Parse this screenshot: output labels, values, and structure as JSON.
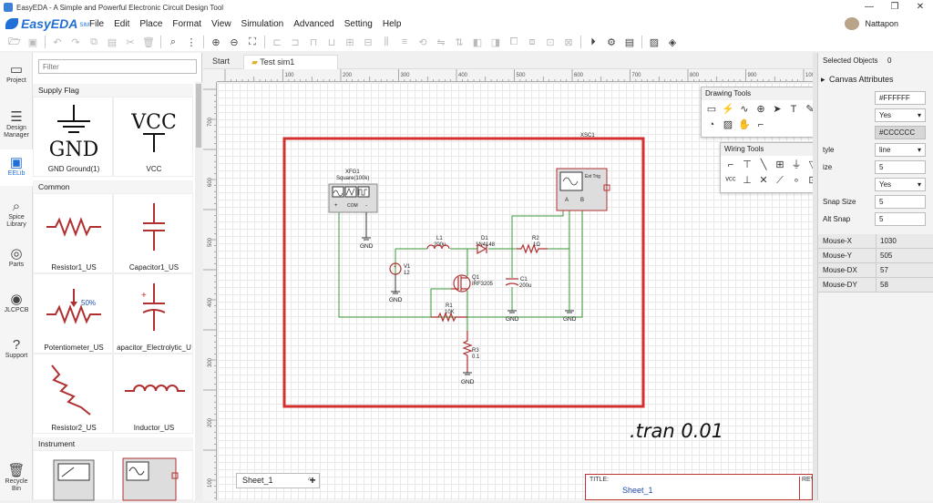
{
  "window": {
    "title": "EasyEDA - A Simple and Powerful Electronic Circuit Design Tool"
  },
  "logo": {
    "name": "EasyEDA",
    "tag": "SIM"
  },
  "menu": [
    "File",
    "Edit",
    "Place",
    "Format",
    "View",
    "Simulation",
    "Advanced",
    "Setting",
    "Help"
  ],
  "user": {
    "name": "Nattapon"
  },
  "search": {
    "placeholder": "Filter"
  },
  "nav": [
    {
      "label": "Project",
      "icon": "folder-icon",
      "glyph": "▭"
    },
    {
      "label": "Design Manager",
      "icon": "list-icon",
      "glyph": "☰"
    },
    {
      "label": "EELib",
      "icon": "chip-icon",
      "glyph": "▣"
    },
    {
      "label": "Spice Library",
      "icon": "search-icon",
      "glyph": "⌕"
    },
    {
      "label": "Parts",
      "icon": "lcsc-icon",
      "glyph": "◎"
    },
    {
      "label": "JLCPCB",
      "icon": "jlc-icon",
      "glyph": "◉"
    },
    {
      "label": "Support",
      "icon": "help-icon",
      "glyph": "?"
    },
    {
      "label": "Recycle Bin",
      "icon": "trash-icon",
      "glyph": "🗑"
    }
  ],
  "library": {
    "sections": [
      "Supply Flag",
      "Common",
      "Instrument"
    ],
    "items": [
      {
        "label": "GND Ground(1)",
        "symbol": "GND"
      },
      {
        "label": "VCC",
        "symbol": "VCC"
      },
      {
        "label": "Resistor1_US"
      },
      {
        "label": "Capacitor1_US"
      },
      {
        "label": "Potentiometer_US",
        "mark": "50%"
      },
      {
        "label": "apacitor_Electrolytic_U"
      },
      {
        "label": "Resistor2_US"
      },
      {
        "label": "Inductor_US"
      }
    ]
  },
  "tabs": [
    {
      "label": "Start"
    },
    {
      "label": "Test sim1"
    }
  ],
  "ruler": {
    "top": [
      "100",
      "200",
      "300",
      "400",
      "500",
      "600",
      "700",
      "800",
      "900",
      "1000"
    ],
    "left": [
      "700",
      "600",
      "500",
      "400",
      "300",
      "200",
      "100"
    ]
  },
  "schematic": {
    "xfg": {
      "name": "XFG1",
      "value": "Square(100k)",
      "pins": [
        "+",
        "COM",
        "-"
      ]
    },
    "xsc": {
      "name": "XSC1",
      "trig": "Ext Trig",
      "pins": [
        "A",
        "B"
      ]
    },
    "L1": {
      "name": "L1",
      "value": "200u"
    },
    "D1": {
      "name": "D1",
      "value": "1N4148"
    },
    "R2": {
      "name": "R2",
      "value": "1Ω"
    },
    "V1": {
      "name": "V1",
      "value": "12"
    },
    "Q1": {
      "name": "Q1",
      "value": "IRF3205"
    },
    "C1": {
      "name": "C1",
      "value": "200u"
    },
    "R1": {
      "name": "R1",
      "value": "10K"
    },
    "R3": {
      "name": "R3",
      "value": "0.1"
    },
    "gnd": "GND"
  },
  "tran": ".tran 0.01",
  "sheet": {
    "tab": "Sheet_1",
    "add": "+",
    "title_label": "TITLE:",
    "title_value": "Sheet_1",
    "rev": "REV"
  },
  "drawing_tools": {
    "title": "Drawing Tools",
    "min": "—",
    "glyphs": [
      "▭",
      "⚡",
      "∿",
      "⊕",
      "➤",
      "T",
      "✎",
      "□",
      "▷",
      "○",
      "◔",
      "▨",
      "✋",
      "⌐"
    ]
  },
  "wiring_tools": {
    "title": "Wiring Tools",
    "min": "—",
    "glyphs": [
      "⌐",
      "⊤",
      "╲",
      "⊞",
      "⏚",
      "▽",
      "▷",
      "ᵛᶜᶜ",
      "⊥",
      "✕",
      "⟋",
      "∘",
      "⊡"
    ]
  },
  "right": {
    "selected_label": "Selected Objects",
    "selected_count": "0",
    "canvas_attr": "Canvas Attributes",
    "fields": [
      {
        "label": "",
        "value": "#FFFFFF"
      },
      {
        "label": "",
        "value": "Yes"
      },
      {
        "label": "",
        "value": "#CCCCCC"
      },
      {
        "label": "tyle",
        "value": "line"
      },
      {
        "label": "ize",
        "value": "5"
      },
      {
        "label": "",
        "value": "Yes"
      },
      {
        "label": "Snap Size",
        "value": "5"
      },
      {
        "label": "Alt Snap",
        "value": "5"
      }
    ],
    "mouse": [
      {
        "k": "Mouse-X",
        "v": "1030"
      },
      {
        "k": "Mouse-Y",
        "v": "505"
      },
      {
        "k": "Mouse-DX",
        "v": "57"
      },
      {
        "k": "Mouse-DY",
        "v": "58"
      }
    ]
  },
  "colors": {
    "accent": "#1f6fd6",
    "highlight": "#d32f2f",
    "wire": "#3a9a3a",
    "component": "#b03030"
  }
}
